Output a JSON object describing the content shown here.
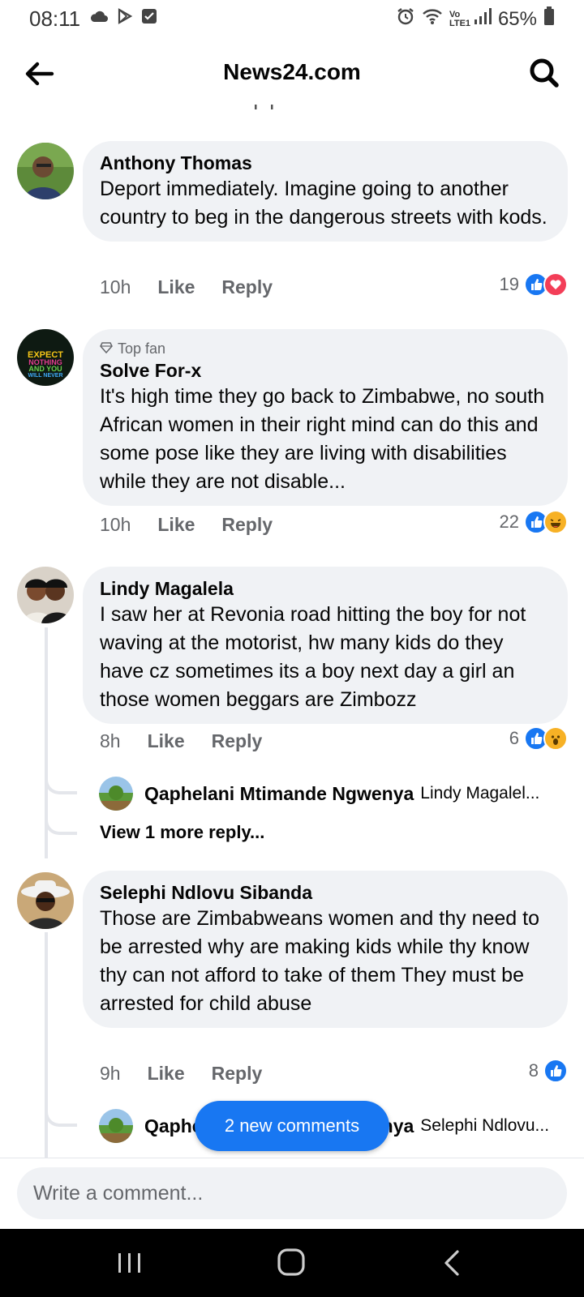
{
  "status_bar": {
    "time": "08:11",
    "battery": "65%",
    "network_label": "Vo LTE1",
    "icons": [
      "cloud-icon",
      "play-store-icon",
      "checkbox-icon",
      "alarm-icon",
      "wifi-icon",
      "signal-icon",
      "battery-icon"
    ]
  },
  "header": {
    "title": "News24.com",
    "back_icon": "back-arrow-icon",
    "search_icon": "search-icon"
  },
  "comments": [
    {
      "author": "Anthony Thomas",
      "text": "Deport immediately. Imagine going to another country to beg in the dangerous streets with kods.",
      "time": "10h",
      "like": "Like",
      "reply": "Reply",
      "reaction_count": "19",
      "reactions": [
        "like",
        "love"
      ]
    },
    {
      "badge": "Top fan",
      "author": "Solve For-x",
      "avatar_text": [
        "EXPECT",
        "NOTHING",
        "AND YOU",
        "WILL NEVER"
      ],
      "text": "It's high time they go back to Zimbabwe, no south African women in their right mind can do this and some pose like they are living with disabilities while they are not disable...",
      "time": "10h",
      "like": "Like",
      "reply": "Reply",
      "reaction_count": "22",
      "reactions": [
        "like",
        "haha"
      ]
    },
    {
      "author": "Lindy Magalela",
      "text": "I saw her at Revonia road hitting the boy for not waving at the motorist,  hw many kids do they have cz sometimes its a boy next day a girl an those women beggars are Zimbozz",
      "time": "8h",
      "like": "Like",
      "reply": "Reply",
      "reaction_count": "6",
      "reactions": [
        "like",
        "wow"
      ],
      "reply_preview": {
        "author": "Qaphelani Mtimande Ngwenya",
        "text": "Lindy Magalel..."
      },
      "more_replies": "View 1 more reply..."
    },
    {
      "author": "Selephi Ndlovu Sibanda",
      "text": "Those  are Zimbabweans  women  and thy need  to be arrested   why are making  kids while  thy  know  thy can not  afford  to take of them They must  be arrested  for child abuse",
      "time": "9h",
      "like": "Like",
      "reply": "Reply",
      "reaction_count": "8",
      "reactions": [
        "like"
      ],
      "reply_preview": {
        "author": "Qaphelani Mtimande Ngwenya",
        "text": "Selephi Ndlovu..."
      }
    }
  ],
  "new_comments_button": "2 new comments",
  "composer": {
    "placeholder": "Write a comment..."
  },
  "nav_bar": {
    "icons": [
      "recent-apps-icon",
      "home-icon",
      "back-nav-icon"
    ]
  },
  "colors": {
    "accent": "#1877f2",
    "bubble": "#f0f2f5",
    "secondary_text": "#65676b"
  }
}
